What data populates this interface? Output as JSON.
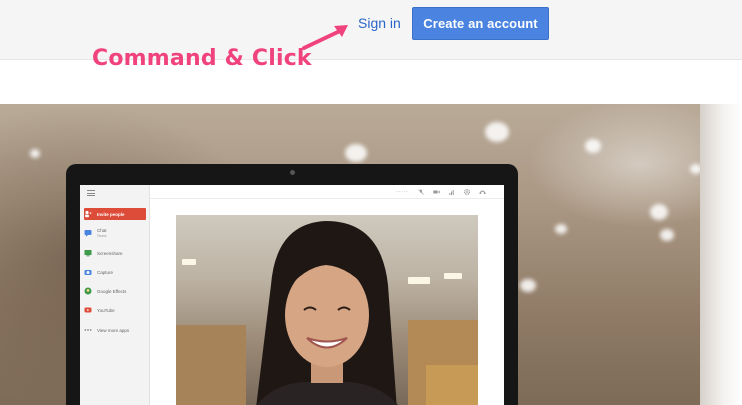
{
  "header": {
    "signin_label": "Sign in",
    "create_account_label": "Create an account"
  },
  "annotation": {
    "text": "Command & Click",
    "color": "#f0437e"
  },
  "app_sidebar": {
    "items": [
      {
        "label": "Invite people",
        "sublabel": "",
        "icon": "add-person-icon"
      },
      {
        "label": "Chat",
        "sublabel": "Seed",
        "icon": "chat-icon"
      },
      {
        "label": "Screenshare",
        "sublabel": "",
        "icon": "screenshare-icon"
      },
      {
        "label": "Capture",
        "sublabel": "",
        "icon": "camera-icon"
      },
      {
        "label": "Google Effects",
        "sublabel": "",
        "icon": "effects-icon"
      },
      {
        "label": "YouTube",
        "sublabel": "",
        "icon": "youtube-icon"
      },
      {
        "label": "View more apps",
        "sublabel": "",
        "icon": "more-icon"
      }
    ]
  },
  "app_toolbar": {
    "icons": [
      "signal-icon",
      "mute-mic-icon",
      "video-off-icon",
      "bandwidth-icon",
      "settings-icon",
      "exit-icon"
    ]
  },
  "colors": {
    "accent_blue": "#4b84e0",
    "link_blue": "#2a64c9",
    "invite_red": "#dd4b39"
  }
}
